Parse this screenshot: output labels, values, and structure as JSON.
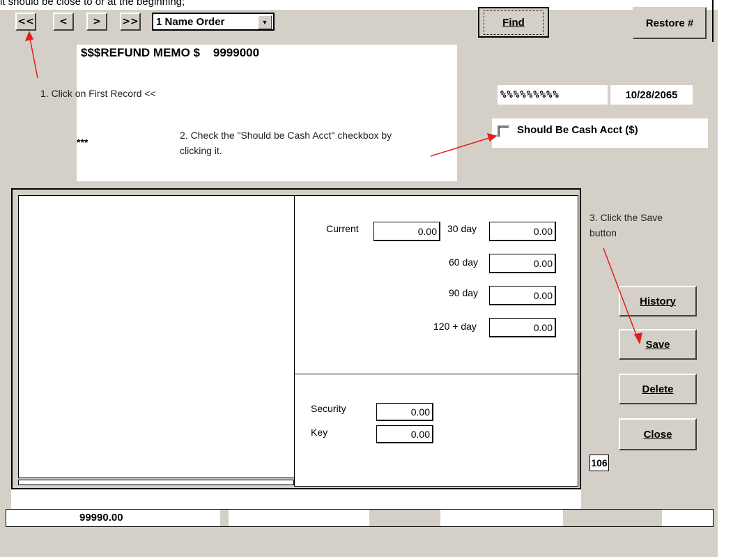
{
  "top_caption": "it should be close to or at the beginning;",
  "nav": {
    "first": "<<",
    "prev": "<",
    "next": ">",
    "last": ">>",
    "order_select": "1 Name Order",
    "find_label": "Find",
    "restore_label": "Restore #"
  },
  "memo": {
    "title_prefix": "$$$REFUND MEMO  $",
    "title_value": "9999000",
    "stars": "***"
  },
  "record": {
    "pct_value": "%%%%%%%%%",
    "date": "10/28/2065",
    "cash_checkbox_label": "Should Be Cash Acct ($)",
    "cash_checked": false
  },
  "annotations": {
    "step1": "1. Click on First Record <<",
    "step2_line1": "2. Check the \"Should be Cash Acct\" checkbox by",
    "step2_line2": "clicking it.",
    "step3_line1": "3. Click the Save",
    "step3_line2": "button"
  },
  "aging": {
    "current_label": "Current",
    "current_value": "0.00",
    "d30_label": "30 day",
    "d30_value": "0.00",
    "d60_label": "60 day",
    "d60_value": "0.00",
    "d90_label": "90 day",
    "d90_value": "0.00",
    "d120_label": "120 + day",
    "d120_value": "0.00"
  },
  "deposits": {
    "security_label": "Security",
    "security_value": "0.00",
    "key_label": "Key",
    "key_value": "0.00"
  },
  "actions": {
    "history": "History",
    "save": "Save",
    "delete": "Delete",
    "close": "Close"
  },
  "record_count": "106",
  "status": {
    "balance": "99990.00"
  },
  "colors": {
    "form_bg": "#d4d0c8",
    "annotation_arrow": "#e0201b"
  }
}
